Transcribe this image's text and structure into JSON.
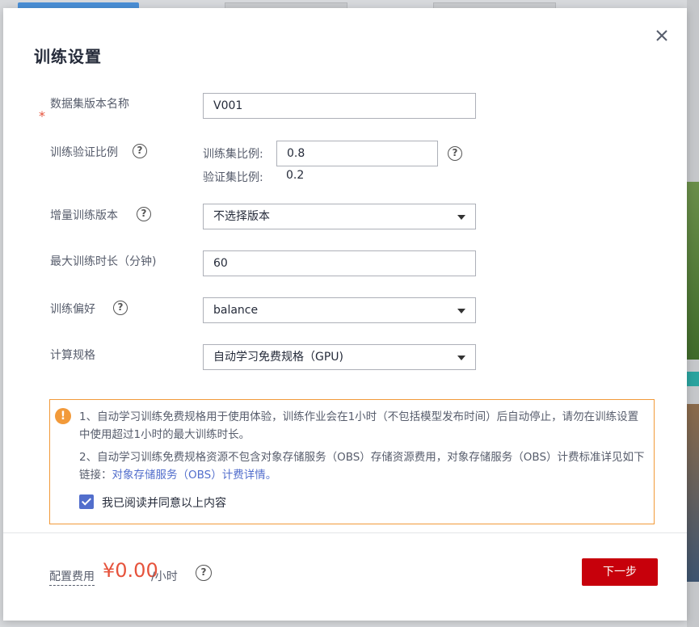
{
  "dialog": {
    "title": "训练设置"
  },
  "form": {
    "dataset_version_name": {
      "label": "数据集版本名称",
      "required_mark": "*",
      "value": "V001"
    },
    "split_ratio": {
      "label": "训练验证比例",
      "train_label": "训练集比例:",
      "train_value": "0.8",
      "val_label": "验证集比例:",
      "val_value": "0.2"
    },
    "incremental_version": {
      "label": "增量训练版本",
      "value": "不选择版本"
    },
    "max_duration": {
      "label": "最大训练时长（分钟)",
      "value": "60"
    },
    "preference": {
      "label": "训练偏好",
      "value": "balance"
    },
    "compute_spec": {
      "label": "计算规格",
      "value": "自动学习免费规格（GPU)"
    }
  },
  "notice": {
    "icon": "!",
    "line1": "1、自动学习训练免费规格用于使用体验，训练作业会在1小时（不包括模型发布时间）后自动停止，请勿在训练设置中使用超过1小时的最大训练时长。",
    "line2_prefix": "2、自动学习训练免费规格资源不包含对象存储服务（OBS）存储资源费用，对象存储服务（OBS）计费标准详见如下链接：",
    "line2_link": "对象存储服务（OBS）计费详情。",
    "agree_label": "我已阅读并同意以上内容",
    "agree_checked": true
  },
  "footer": {
    "fee_label": "配置费用",
    "price": "¥0.00",
    "unit": "/小时",
    "next_label": "下一步"
  },
  "icons": {
    "help": "?",
    "close": "close-icon"
  },
  "colors": {
    "primary_red": "#c7000b",
    "warning_orange": "#f29a3a",
    "link_blue": "#526ecc",
    "price_red": "#e6533c"
  }
}
